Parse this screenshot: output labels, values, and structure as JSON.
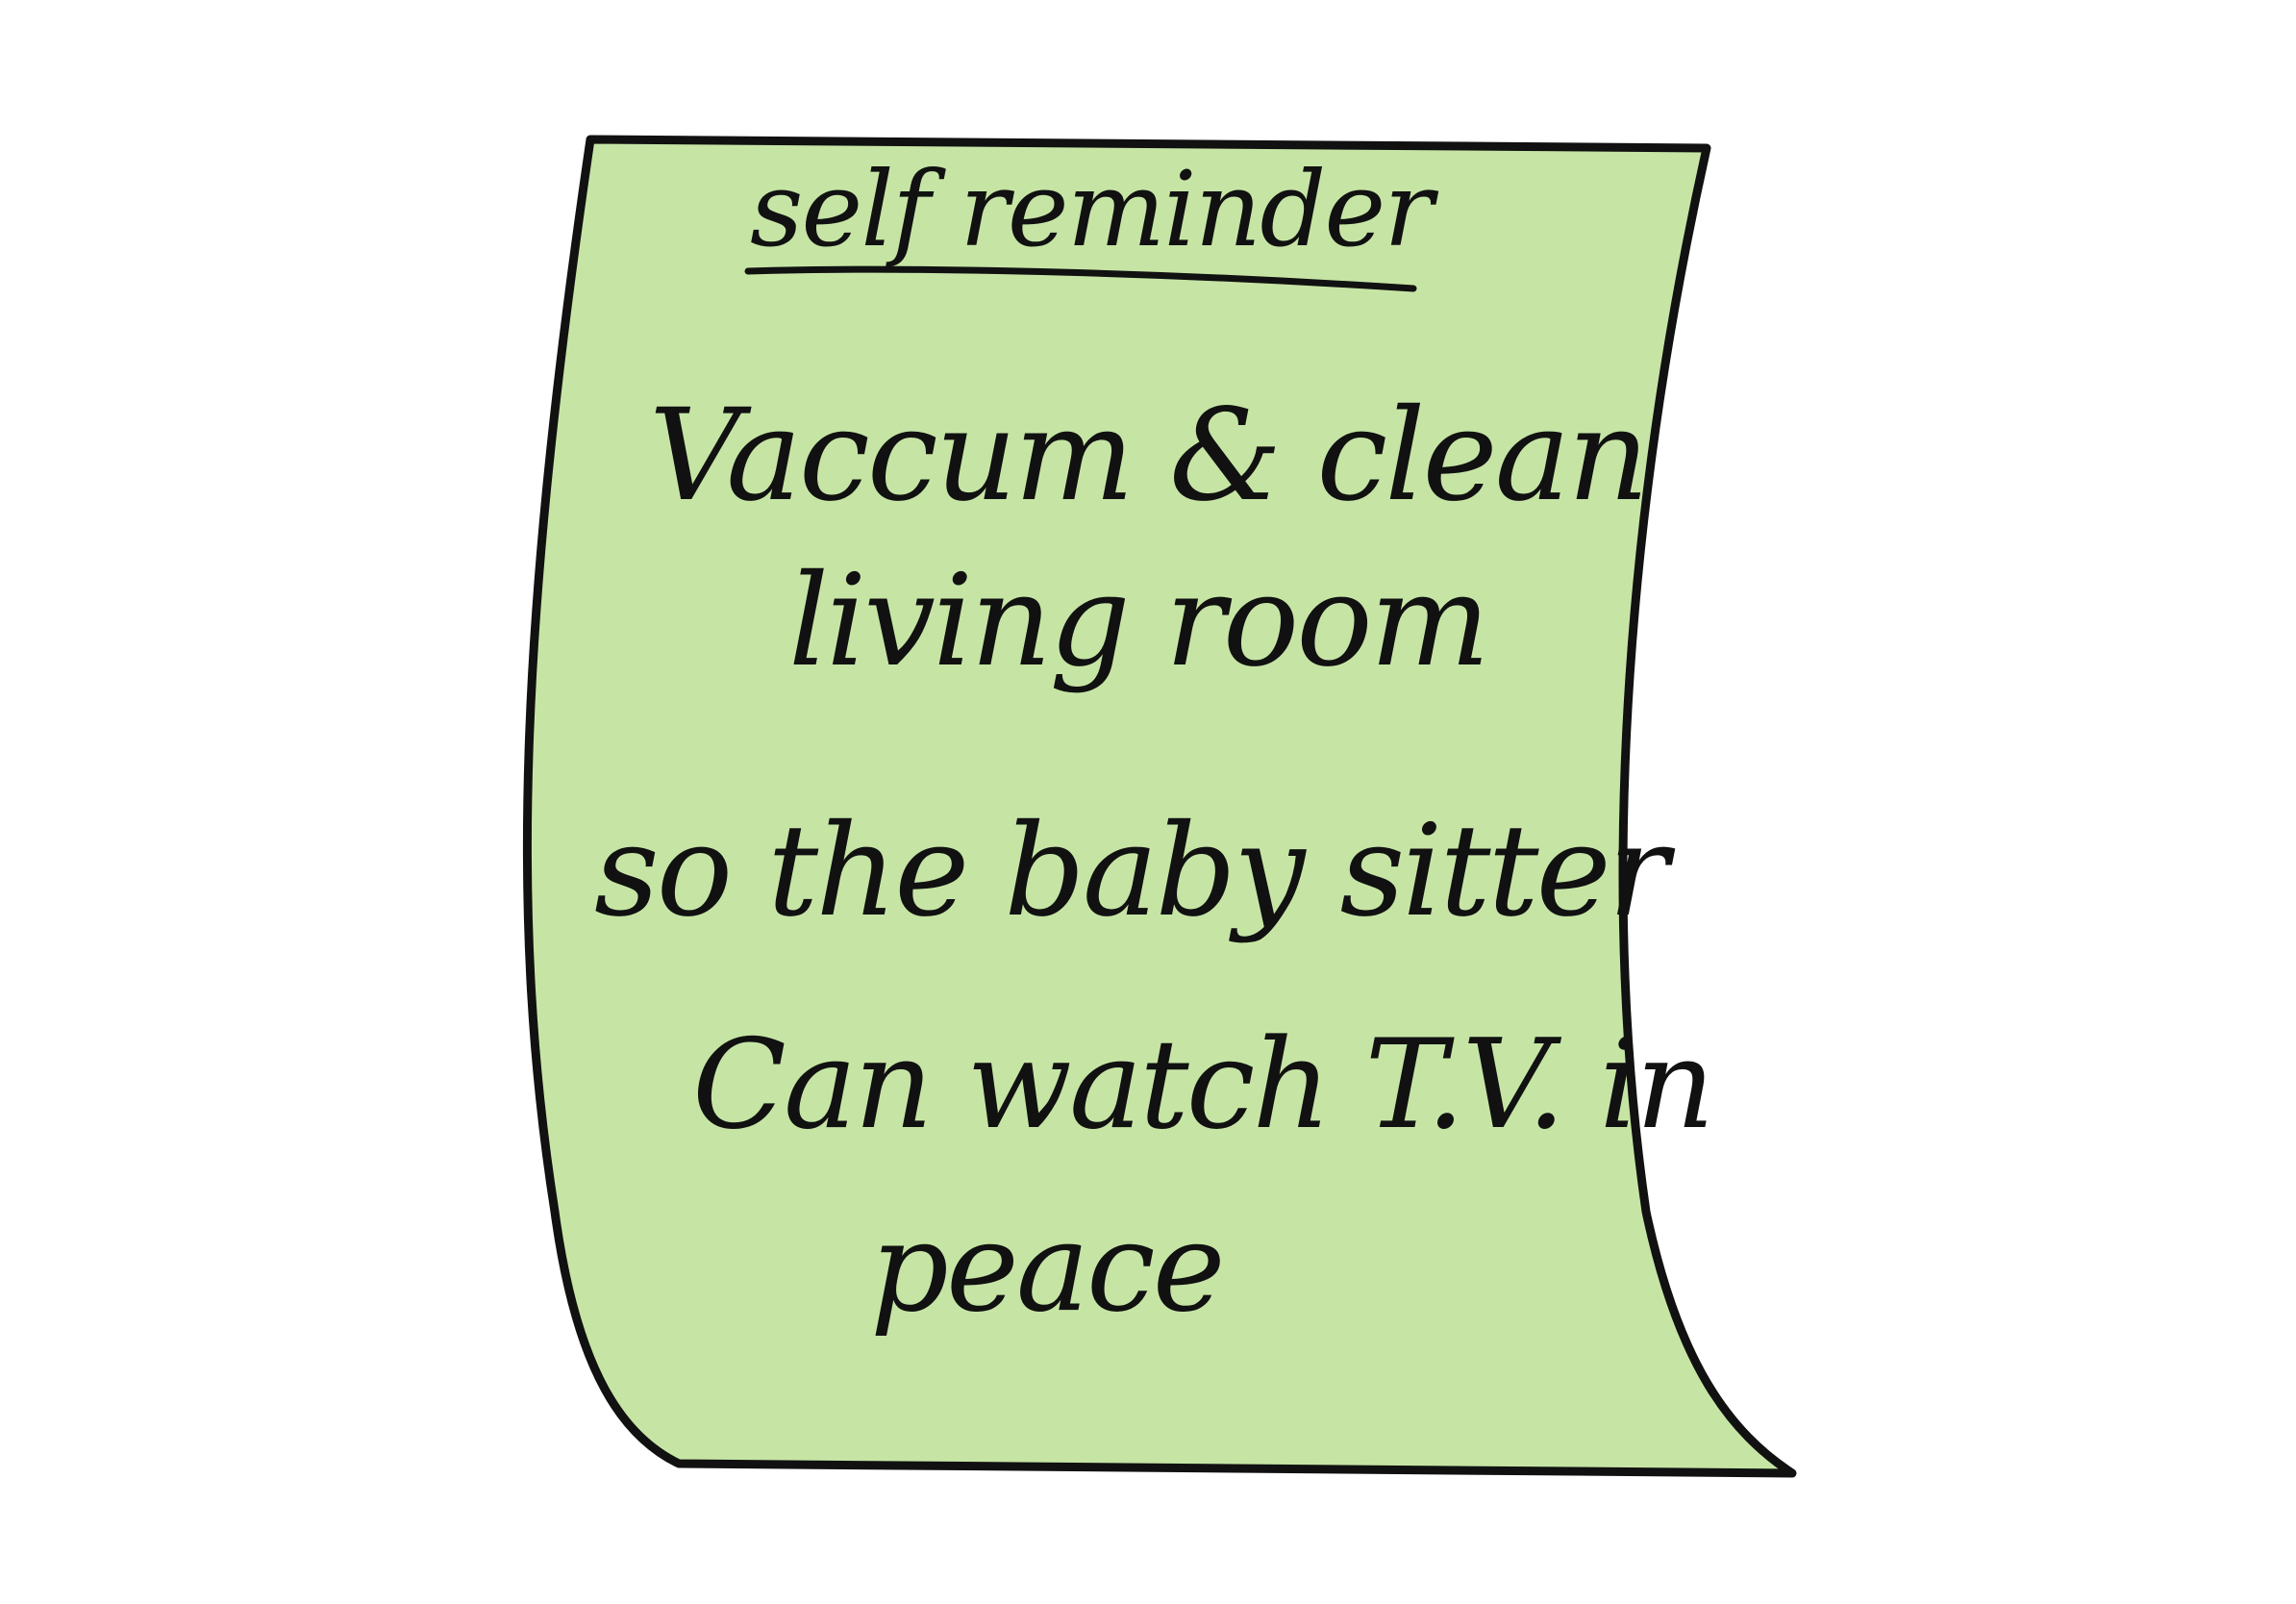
{
  "note": {
    "title": "self reminder",
    "lines": [
      "Vaccum & clean",
      "living room",
      "so the baby sitter",
      "Can watch T.V. in",
      "peace"
    ]
  },
  "colors": {
    "note_fill": "#c6e5a5",
    "outline": "#111111",
    "ink": "#111111",
    "background": "#ffffff"
  }
}
